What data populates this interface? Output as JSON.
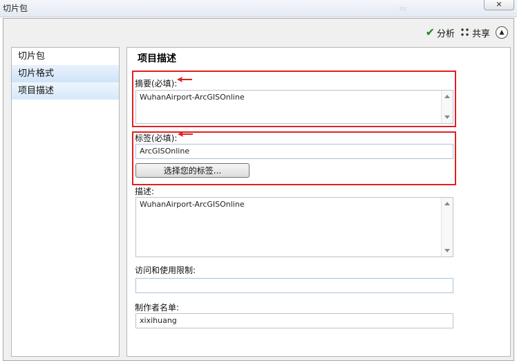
{
  "window": {
    "title": "切片包",
    "close_label": "✕"
  },
  "toolbar": {
    "analyze_label": "分析",
    "share_label": "共享"
  },
  "sidebar": {
    "items": [
      {
        "label": "切片包"
      },
      {
        "label": "切片格式"
      },
      {
        "label": "项目描述"
      }
    ]
  },
  "main": {
    "title": "项目描述",
    "summary": {
      "label": "摘要(必填):",
      "value": "WuhanAirport-ArcGISOnline"
    },
    "tags": {
      "label": "标签(必填):",
      "value": "ArcGISOnline",
      "button_label": "选择您的标签..."
    },
    "description": {
      "label": "描述:",
      "value": "WuhanAirport-ArcGISOnline"
    },
    "access": {
      "label": "访问和使用限制:",
      "value": ""
    },
    "credits": {
      "label": "制作者名单:",
      "value": "xixihuang"
    }
  },
  "colors": {
    "highlight_box": "#e02020",
    "selected_item": "#cfe3f8"
  }
}
